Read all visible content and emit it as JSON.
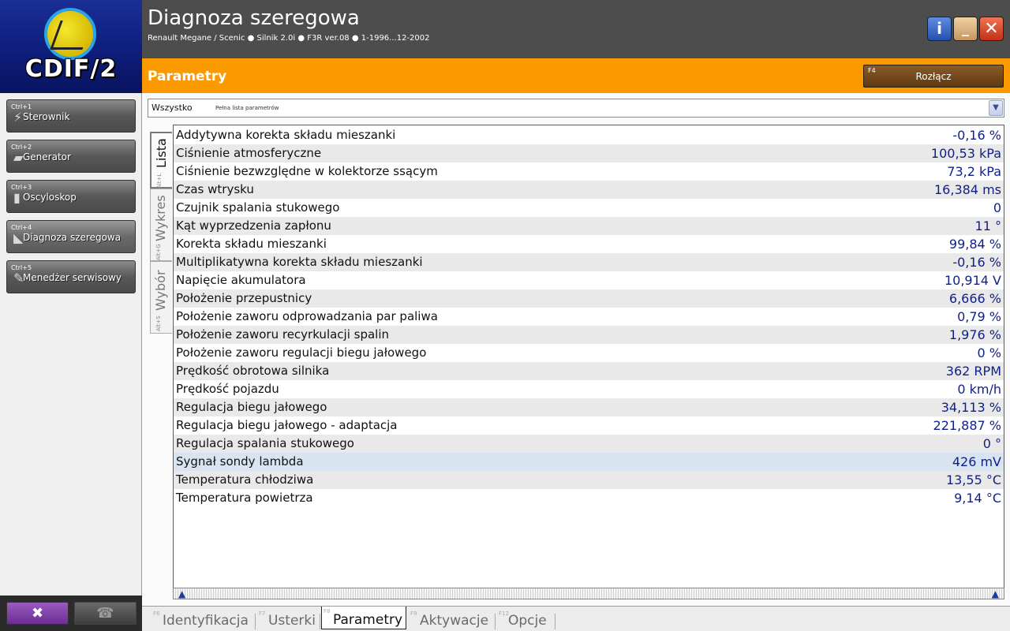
{
  "app": {
    "logo_text": "CDIF/2"
  },
  "header": {
    "title": "Diagnoza szeregowa",
    "vehicle": "Renault Megane / Scenic ● Silnik 2.0i ● F3R ver.08 ● 1-1996...12-2002"
  },
  "sidebar": {
    "items": [
      {
        "shortcut": "Ctrl+1",
        "label": "Sterownik"
      },
      {
        "shortcut": "Ctrl+2",
        "label": "Generator"
      },
      {
        "shortcut": "Ctrl+3",
        "label": "Oscyloskop"
      },
      {
        "shortcut": "Ctrl+4",
        "label": "Diagnoza szeregowa"
      },
      {
        "shortcut": "Ctrl+5",
        "label": "Menedżer serwisowy"
      }
    ]
  },
  "section": {
    "title": "Parametry",
    "disconnect": {
      "shortcut": "F4",
      "label": "Rozłącz"
    }
  },
  "filter": {
    "value": "Wszystko",
    "description": "Pełna lista parametrów"
  },
  "side_tabs": [
    {
      "label": "Lista",
      "shortcut": "Alt+L"
    },
    {
      "label": "Wykres",
      "shortcut": "Alt+G"
    },
    {
      "label": "Wybór",
      "shortcut": "Alt+S"
    }
  ],
  "parameters": [
    {
      "name": "Addytywna korekta składu mieszanki",
      "value": "-0,16 %"
    },
    {
      "name": "Ciśnienie atmosferyczne",
      "value": "100,53 kPa"
    },
    {
      "name": "Ciśnienie bezwzględne w kolektorze ssącym",
      "value": "73,2 kPa"
    },
    {
      "name": "Czas wtrysku",
      "value": "16,384 ms"
    },
    {
      "name": "Czujnik spalania stukowego",
      "value": "0"
    },
    {
      "name": "Kąt wyprzedzenia zapłonu",
      "value": "11 °"
    },
    {
      "name": "Korekta składu mieszanki",
      "value": "99,84 %"
    },
    {
      "name": "Multiplikatywna korekta składu mieszanki",
      "value": "-0,16 %"
    },
    {
      "name": "Napięcie akumulatora",
      "value": "10,914 V"
    },
    {
      "name": "Położenie przepustnicy",
      "value": "6,666 %"
    },
    {
      "name": "Położenie zaworu odprowadzania par paliwa",
      "value": "0,79 %"
    },
    {
      "name": "Położenie zaworu recyrkulacji spalin",
      "value": "1,976 %"
    },
    {
      "name": "Położenie zaworu regulacji biegu jałowego",
      "value": "0 %"
    },
    {
      "name": "Prędkość obrotowa silnika",
      "value": "362 RPM"
    },
    {
      "name": "Prędkość pojazdu",
      "value": "0 km/h"
    },
    {
      "name": "Regulacja biegu jałowego",
      "value": "34,113 %"
    },
    {
      "name": "Regulacja biegu jałowego - adaptacja",
      "value": "221,887 %"
    },
    {
      "name": "Regulacja spalania stukowego",
      "value": "0 °"
    },
    {
      "name": "Sygnał sondy lambda",
      "value": "426 mV"
    },
    {
      "name": "Temperatura chłodziwa",
      "value": "13,55 °C"
    },
    {
      "name": "Temperatura powietrza",
      "value": "9,14 °C"
    }
  ],
  "bottom_tabs": [
    {
      "shortcut": "F6",
      "label": "Identyfikacja"
    },
    {
      "shortcut": "F7",
      "label": "Usterki"
    },
    {
      "shortcut": "F8",
      "label": "Parametry"
    },
    {
      "shortcut": "F9",
      "label": "Aktywacje"
    },
    {
      "shortcut": "F12",
      "label": "Opcje"
    }
  ],
  "icons": {
    "tools": "✖",
    "phone": "☎",
    "info": "i",
    "minimize": "_",
    "close": "✕",
    "dropdown": "▼",
    "scroll_up": "▲"
  },
  "colors": {
    "accent": "#fb9a00",
    "header_bg": "#4d4d4d",
    "value_text": "#0e1f8a",
    "logo_bg": "#0d1c78"
  }
}
